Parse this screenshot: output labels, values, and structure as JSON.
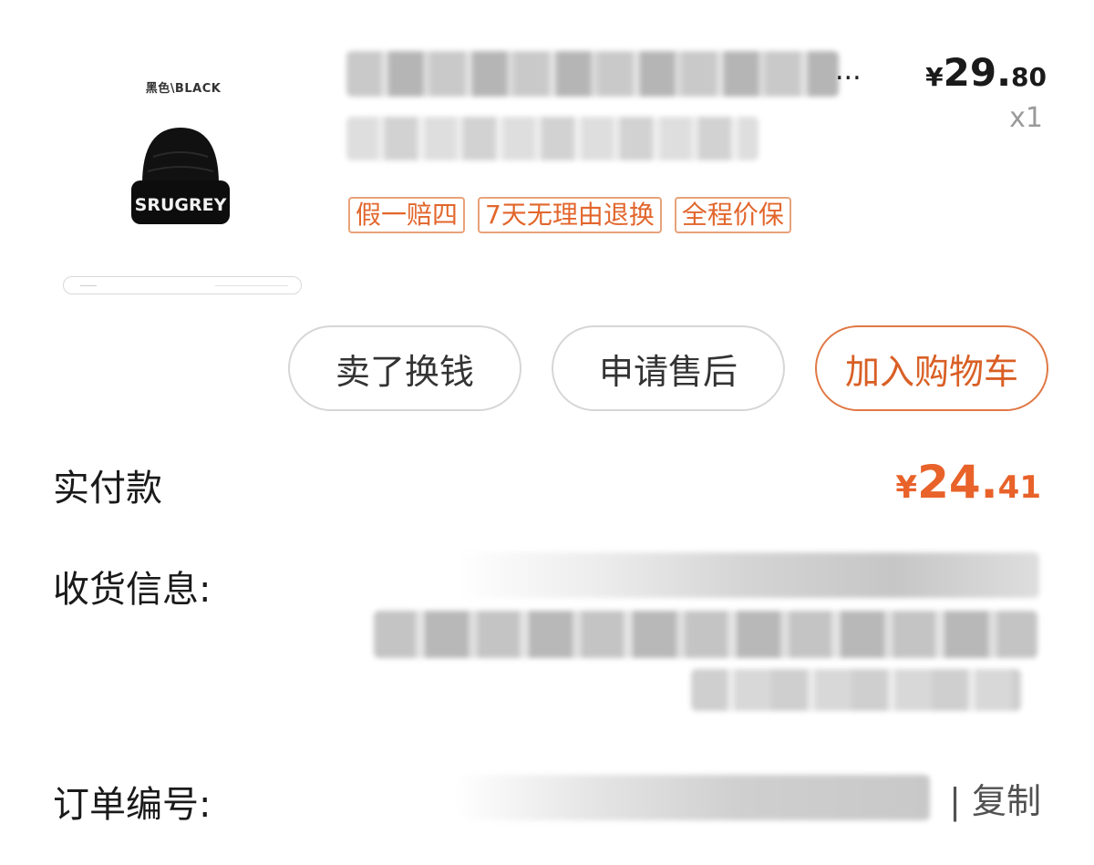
{
  "product": {
    "thumbnail_caption": "黑色\\BLACK",
    "hat_text": "SRUGREY",
    "title_ellipsis": "...",
    "price": {
      "currency": "¥",
      "integer": "29.",
      "decimal": "80"
    },
    "quantity": "x1",
    "tags": [
      "假一赔四",
      "7天无理由退换",
      "全程价保"
    ]
  },
  "actions": {
    "sell": "卖了换钱",
    "after_sale": "申请售后",
    "add_to_cart": "加入购物车"
  },
  "order": {
    "paid_label": "实付款",
    "paid_amount": {
      "currency": "¥",
      "integer": "24.",
      "decimal": "41"
    },
    "shipping_label": "收货信息:",
    "order_no_label": "订单编号:",
    "copy_label": "| 复制"
  },
  "colors": {
    "accent": "#e8622a",
    "tag_border": "#e8a27a",
    "button_border": "#d6d6d6"
  }
}
